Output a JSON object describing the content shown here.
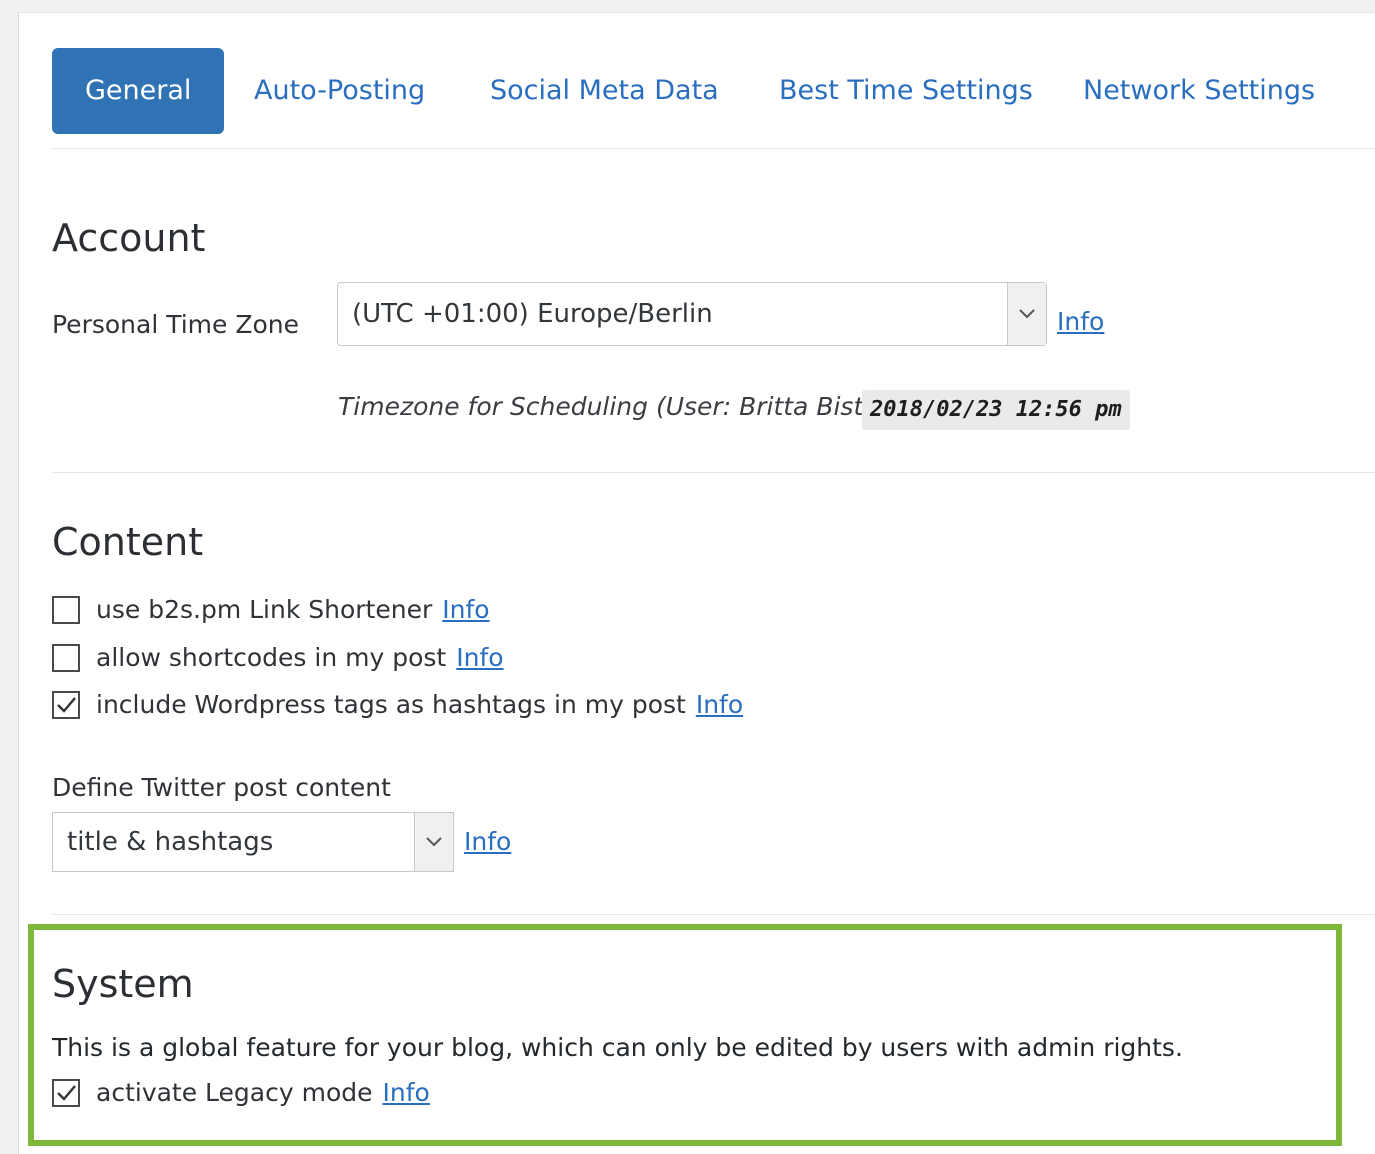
{
  "tabs": [
    {
      "label": "General",
      "active": true
    },
    {
      "label": "Auto-Posting"
    },
    {
      "label": "Social Meta Data"
    },
    {
      "label": "Best Time Settings"
    },
    {
      "label": "Network Settings"
    }
  ],
  "account": {
    "title": "Account",
    "timezone_label": "Personal Time Zone",
    "timezone_value": "(UTC +01:00) Europe/Berlin",
    "info": "Info",
    "scheduling_note": "Timezone for Scheduling (User: Britta Bist)",
    "scheduling_time": "2018/02/23 12:56 pm"
  },
  "content": {
    "title": "Content",
    "options": [
      {
        "label": "use b2s.pm Link Shortener",
        "checked": false,
        "info": "Info"
      },
      {
        "label": "allow shortcodes in my post",
        "checked": false,
        "info": "Info"
      },
      {
        "label": "include Wordpress tags as hashtags in my post",
        "checked": true,
        "info": "Info"
      }
    ],
    "twitter_label": "Define Twitter post content",
    "twitter_value": "title & hashtags",
    "twitter_info": "Info"
  },
  "system": {
    "title": "System",
    "description": "This is a global feature for your blog, which can only be edited by users with admin rights.",
    "legacy_label": "activate Legacy mode",
    "legacy_checked": true,
    "info": "Info"
  },
  "colors": {
    "accent": "#2f73b5",
    "link": "#2a6ec0",
    "highlight_border": "#7db83a"
  }
}
